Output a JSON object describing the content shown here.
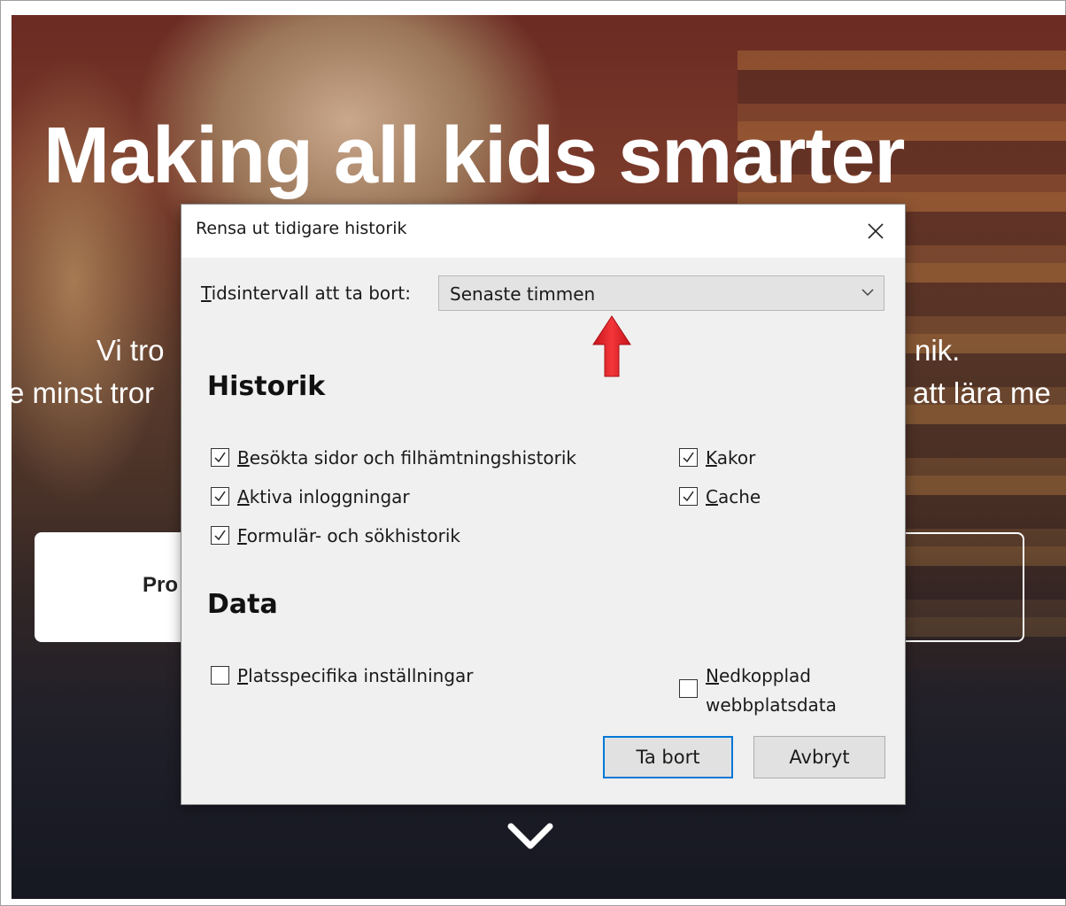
{
  "background_page": {
    "hero_title": "Making all kids smarter",
    "hero_line_1_left": "Vi tro",
    "hero_line_1_right": "nik.",
    "hero_line_2_left": "e minst tror",
    "hero_line_2_right": "att lära me",
    "left_button_partial": "Pro"
  },
  "dialog": {
    "title": "Rensa ut tidigare historik",
    "time_range": {
      "label_accel": "T",
      "label_rest": "idsintervall att ta bort:",
      "selected": "Senaste timmen"
    },
    "history_heading": "Historik",
    "history_items": [
      {
        "accel": "B",
        "rest": "esökta sidor och filhämtningshistorik",
        "checked": true
      },
      {
        "accel": "A",
        "rest": "ktiva inloggningar",
        "checked": true
      },
      {
        "accel": "F",
        "rest": "ormulär- och sökhistorik",
        "checked": true
      },
      {
        "accel": "K",
        "rest": "akor",
        "checked": true
      },
      {
        "accel": "C",
        "rest": "ache",
        "checked": true
      }
    ],
    "data_heading": "Data",
    "data_items": [
      {
        "accel": "P",
        "rest": "latsspecifika inställningar",
        "checked": false
      },
      {
        "accel": "N",
        "rest": "edkopplad",
        "line2": "webbplatsdata",
        "checked": false
      }
    ],
    "buttons": {
      "delete": "Ta bort",
      "cancel": "Avbryt"
    }
  },
  "colors": {
    "dialog_bg": "#f0f0f0",
    "primary_border": "#0078d7",
    "annotation_arrow": "#e8242a"
  },
  "icons": [
    "close-icon",
    "chevron-down-icon",
    "checkmark-icon",
    "red-arrow-up-icon",
    "scroll-down-chevron-icon"
  ]
}
